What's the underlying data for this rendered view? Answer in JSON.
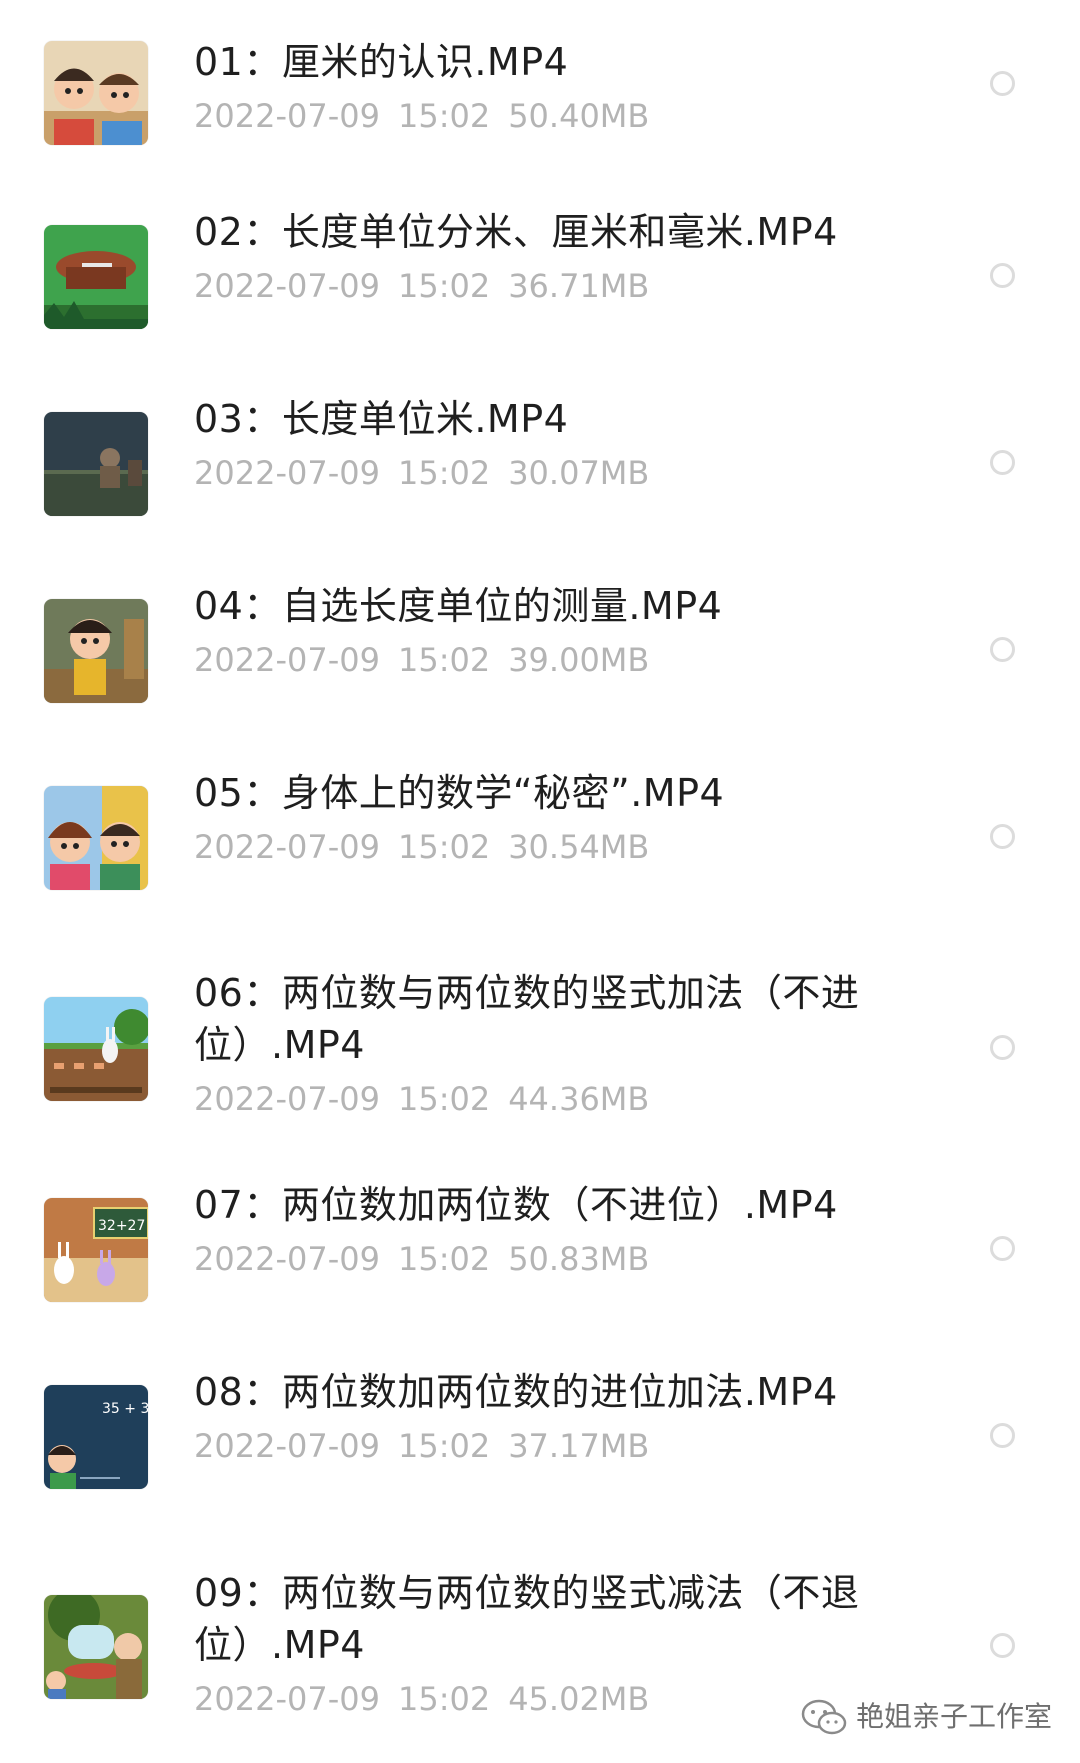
{
  "files": [
    {
      "name": "01：厘米的认识.MP4",
      "date": "2022-07-09",
      "time": "15:02",
      "size": "50.40MB",
      "thumbnail": "cartoon-children-icon"
    },
    {
      "name": "02：长度单位分米、厘米和毫米.MP4",
      "date": "2022-07-09",
      "time": "15:02",
      "size": "36.71MB",
      "thumbnail": "table-ruler-icon"
    },
    {
      "name": "03：长度单位米.MP4",
      "date": "2022-07-09",
      "time": "15:02",
      "size": "30.07MB",
      "thumbnail": "night-field-icon"
    },
    {
      "name": "04：自选长度单位的测量.MP4",
      "date": "2022-07-09",
      "time": "15:02",
      "size": "39.00MB",
      "thumbnail": "cartoon-girl-icon"
    },
    {
      "name": "05：身体上的数学“秘密”.MP4",
      "date": "2022-07-09",
      "time": "15:02",
      "size": "30.54MB",
      "thumbnail": "cartoon-kids-icon"
    },
    {
      "name": "06：两位数与两位数的竖式加法（不进位）.MP4",
      "date": "2022-07-09",
      "time": "15:02",
      "size": "44.36MB",
      "thumbnail": "garden-rabbit-icon"
    },
    {
      "name": "07：两位数加两位数（不进位）.MP4",
      "date": "2022-07-09",
      "time": "15:02",
      "size": "50.83MB",
      "thumbnail": "blackboard-rabbits-icon",
      "thumb_text": "32+27"
    },
    {
      "name": "08：两位数加两位数的进位加法.MP4",
      "date": "2022-07-09",
      "time": "15:02",
      "size": "37.17MB",
      "thumbnail": "blue-board-kid-icon",
      "thumb_text": "35 + 3"
    },
    {
      "name": "09：两位数与两位数的竖式减法（不退位）.MP4",
      "date": "2022-07-09",
      "time": "15:02",
      "size": "45.02MB",
      "thumbnail": "forest-elder-icon"
    }
  ],
  "watermark": {
    "text": "艳姐亲子工作室",
    "icon": "wechat-icon"
  },
  "colors": {
    "title": "#1f1f1f",
    "meta": "#b4b4b4",
    "radio_border": "#dcdcdc",
    "background": "#ffffff"
  }
}
